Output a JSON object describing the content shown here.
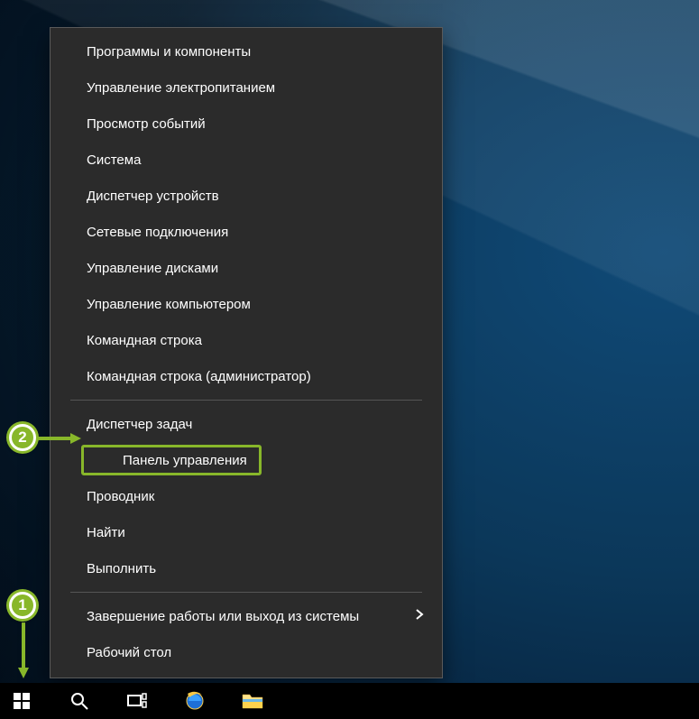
{
  "menu": {
    "groups": [
      [
        "Программы и компоненты",
        "Управление электропитанием",
        "Просмотр событий",
        "Система",
        "Диспетчер устройств",
        "Сетевые подключения",
        "Управление дисками",
        "Управление компьютером",
        "Командная строка",
        "Командная строка (администратор)"
      ],
      [
        "Диспетчер задач",
        "Панель управления",
        "Проводник",
        "Найти",
        "Выполнить"
      ],
      [
        "Завершение работы или выход из системы",
        "Рабочий стол"
      ]
    ],
    "submenu_item": "Завершение работы или выход из системы",
    "highlighted_item": "Панель управления"
  },
  "callouts": {
    "start": "1",
    "control_panel": "2"
  },
  "taskbar": {
    "icons": [
      "start",
      "search",
      "taskview",
      "ie",
      "explorer"
    ]
  }
}
